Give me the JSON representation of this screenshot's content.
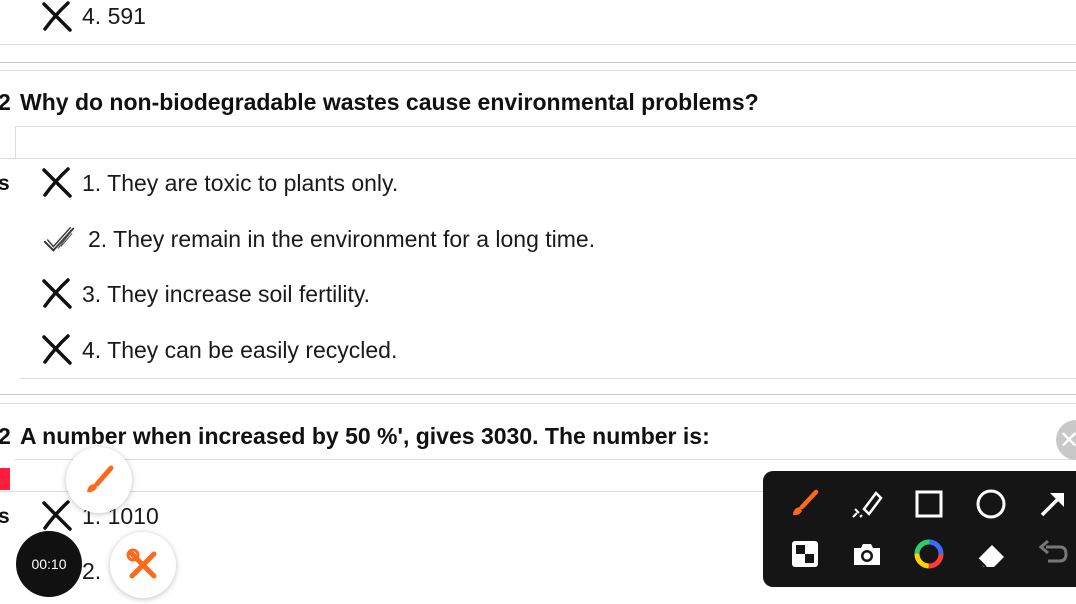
{
  "prev_option": {
    "text": "4. 591"
  },
  "q1": {
    "number": "2",
    "text": "Why do non-biodegradable wastes cause environmental problems?",
    "side_label": "s",
    "options": [
      {
        "text": "1. They are toxic to plants only.",
        "mark": "cross"
      },
      {
        "text": "2. They remain in the environment for a long time.",
        "mark": "check"
      },
      {
        "text": "3. They increase soil fertility.",
        "mark": "cross"
      },
      {
        "text": "4. They can be easily recycled.",
        "mark": "cross"
      }
    ]
  },
  "q2": {
    "number": "2",
    "text": "A number when increased by 50 %', gives 3030. The number is:",
    "side_label": "s",
    "options": [
      {
        "text": "1. 1010",
        "mark": "cross"
      },
      {
        "text": "2.",
        "mark": "cross"
      }
    ]
  },
  "recorder": {
    "timer": "00:10"
  },
  "annotation_toolbar": {
    "tools": [
      "brush-icon",
      "highlighter-icon",
      "rectangle-icon",
      "circle-icon",
      "arrow-icon",
      "mosaic-icon",
      "camera-icon",
      "color-wheel-icon",
      "eraser-icon",
      "undo-icon"
    ],
    "accent": "#ff6a1a"
  }
}
